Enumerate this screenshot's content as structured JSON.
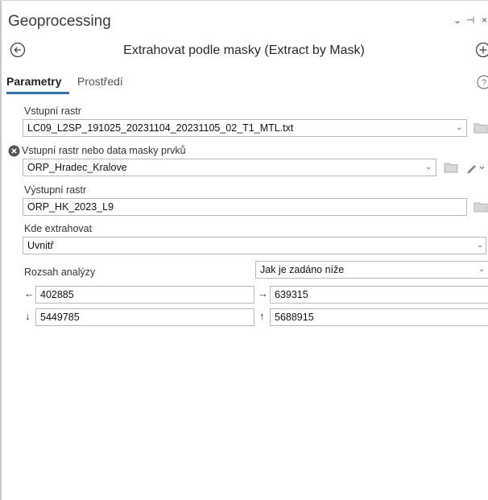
{
  "pane": {
    "title": "Geoprocessing",
    "controls": {
      "menu": "⌄",
      "pin": "⊣",
      "close": "×"
    }
  },
  "tool": {
    "title": "Extrahovat podle masky (Extract by Mask)"
  },
  "tabs": [
    {
      "label": "Parametry",
      "active": true
    },
    {
      "label": "Prostředí",
      "active": false
    }
  ],
  "params": {
    "input_raster": {
      "label": "Vstupní rastr",
      "value": "LC09_L2SP_191025_20231104_20231105_02_T1_MTL.txt"
    },
    "mask": {
      "label": "Vstupní rastr nebo data masky prvků",
      "value": "ORP_Hradec_Kralove",
      "status": "error"
    },
    "output_raster": {
      "label": "Výstupní rastr",
      "value": "ORP_HK_2023_L9"
    },
    "extraction_area": {
      "label": "Kde extrahovat",
      "value": "Uvnitř"
    },
    "analysis_extent": {
      "label": "Rozsah analýzy",
      "mode": "Jak je zadáno níže",
      "left": "402885",
      "right": "639315",
      "bottom": "5449785",
      "top": "5688915"
    }
  },
  "colors": {
    "accent": "#3b6ea5",
    "error": "#444444",
    "border": "#b9b9b9"
  },
  "icons": [
    "back-icon",
    "add-icon",
    "help-icon",
    "error-icon",
    "folder-icon",
    "pencil-icon",
    "chevron-down-icon",
    "arrow-left-icon",
    "arrow-right-icon",
    "arrow-down-icon",
    "arrow-up-icon"
  ]
}
